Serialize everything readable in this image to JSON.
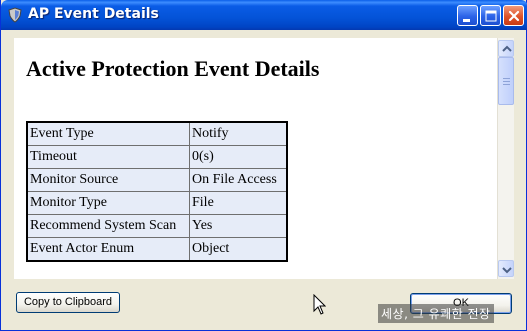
{
  "window": {
    "title": "AP Event Details",
    "icon": "shield-app-icon"
  },
  "titlebar_buttons": [
    "minimize-icon",
    "maximize-icon",
    "close-icon"
  ],
  "content": {
    "heading": "Active Protection Event Details",
    "rows": [
      {
        "key": "Event Type",
        "value": "Notify"
      },
      {
        "key": "Timeout",
        "value": "0(s)"
      },
      {
        "key": "Monitor Source",
        "value": "On File Access"
      },
      {
        "key": "Monitor Type",
        "value": "File"
      },
      {
        "key": "Recommend System Scan",
        "value": "Yes"
      },
      {
        "key": "Event Actor Enum",
        "value": "Object"
      }
    ]
  },
  "buttons": {
    "copy": "Copy to Clipboard",
    "ok": "OK"
  },
  "overlay": {
    "watermark": "세상, 그 유쾌한 전장"
  },
  "colors": {
    "titlebar": "#0453d7",
    "table_cell_bg": "#e6ecf8",
    "window_bg": "#ece9d8"
  }
}
